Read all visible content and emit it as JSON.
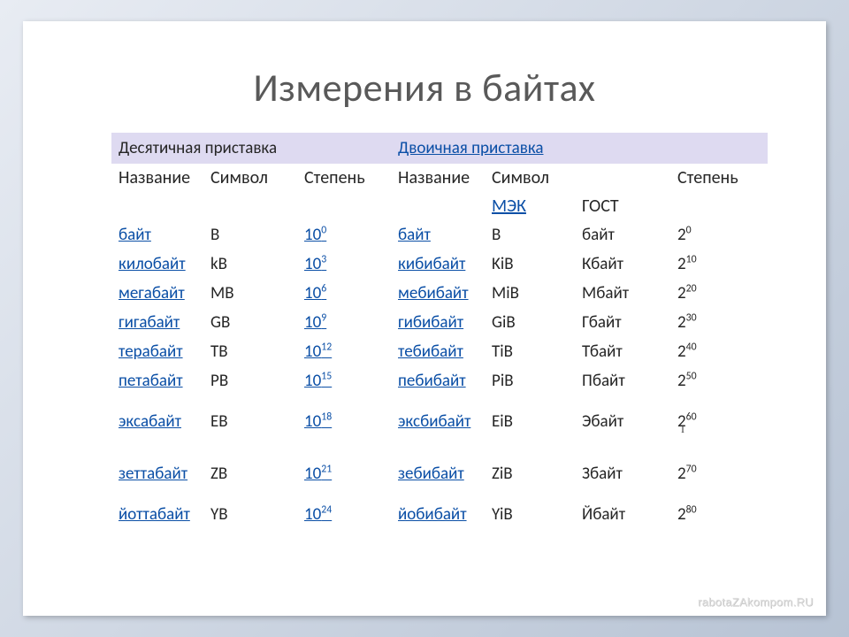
{
  "title": "Измерения в байтах",
  "section_headers": {
    "decimal": "Десятичная приставка",
    "binary": "Двоичная приставка"
  },
  "column_headers": {
    "name": "Название",
    "symbol": "Символ",
    "power": "Степень",
    "iec": "МЭК",
    "gost": "ГОСТ"
  },
  "chart_data": {
    "type": "table",
    "title": "Измерения в байтах",
    "columns": [
      "dec_name",
      "dec_symbol",
      "dec_base",
      "dec_exp",
      "bin_name",
      "bin_symbol_iec",
      "bin_symbol_gost",
      "bin_base",
      "bin_exp"
    ],
    "rows": [
      {
        "dec_name": "байт",
        "dec_symbol": "B",
        "dec_base": "10",
        "dec_exp": "0",
        "bin_name": "байт",
        "bin_symbol_iec": "B",
        "bin_symbol_gost": "байт",
        "bin_base": "2",
        "bin_exp": "0"
      },
      {
        "dec_name": "килобайт",
        "dec_symbol": "kB",
        "dec_base": "10",
        "dec_exp": "3",
        "bin_name": "кибибайт",
        "bin_symbol_iec": "KiB",
        "bin_symbol_gost": "Кбайт",
        "bin_base": "2",
        "bin_exp": "10"
      },
      {
        "dec_name": "мегабайт",
        "dec_symbol": "MB",
        "dec_base": "10",
        "dec_exp": "6",
        "bin_name": "мебибайт",
        "bin_symbol_iec": "MiB",
        "bin_symbol_gost": "Мбайт",
        "bin_base": "2",
        "bin_exp": "20"
      },
      {
        "dec_name": "гигабайт",
        "dec_symbol": "GB",
        "dec_base": "10",
        "dec_exp": "9",
        "bin_name": "гибибайт",
        "bin_symbol_iec": "GiB",
        "bin_symbol_gost": "Гбайт",
        "bin_base": "2",
        "bin_exp": "30"
      },
      {
        "dec_name": "терабайт",
        "dec_symbol": "TB",
        "dec_base": "10",
        "dec_exp": "12",
        "bin_name": "тебибайт",
        "bin_symbol_iec": "TiB",
        "bin_symbol_gost": "Тбайт",
        "bin_base": "2",
        "bin_exp": "40"
      },
      {
        "dec_name": "петабайт",
        "dec_symbol": "PB",
        "dec_base": "10",
        "dec_exp": "15",
        "bin_name": "пебибайт",
        "bin_symbol_iec": "PiB",
        "bin_symbol_gost": "Пбайт",
        "bin_base": "2",
        "bin_exp": "50"
      },
      {
        "dec_name": "эксабайт",
        "dec_symbol": "EB",
        "dec_base": "10",
        "dec_exp": "18",
        "bin_name": "эксбибайт",
        "bin_symbol_iec": "EiB",
        "bin_symbol_gost": "Эбайт",
        "bin_base": "2",
        "bin_exp": "60",
        "spaced": true
      },
      {
        "dec_name": "зеттабайт",
        "dec_symbol": "ZB",
        "dec_base": "10",
        "dec_exp": "21",
        "bin_name": "зебибайт",
        "bin_symbol_iec": "ZiB",
        "bin_symbol_gost": "Збайт",
        "bin_base": "2",
        "bin_exp": "70",
        "spaced": true
      },
      {
        "dec_name": "йоттабайт",
        "dec_symbol": "YB",
        "dec_base": "10",
        "dec_exp": "24",
        "bin_name": "йобибайт",
        "bin_symbol_iec": "YiB",
        "bin_symbol_gost": "Йбайт",
        "bin_base": "2",
        "bin_exp": "80"
      }
    ]
  },
  "watermark": "rabotaZAkompom.RU",
  "cursor": "I"
}
